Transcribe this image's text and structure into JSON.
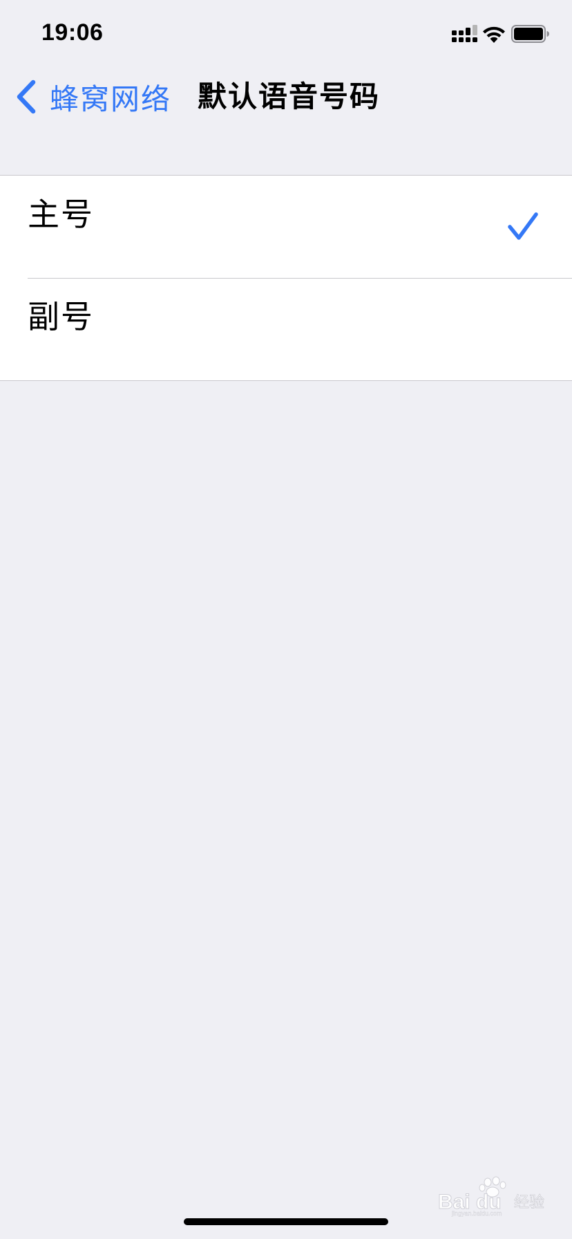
{
  "status_bar": {
    "time": "19:06",
    "icons": [
      "cellular-signal-icon",
      "wifi-icon",
      "battery-icon"
    ]
  },
  "nav": {
    "back_label": "蜂窝网络",
    "title": "默认语音号码",
    "back_icon": "chevron-left-icon"
  },
  "options": [
    {
      "label": "主号",
      "selected": true
    },
    {
      "label": "副号",
      "selected": false
    }
  ],
  "watermark": {
    "text": "Baidu 经验",
    "subtext": "jingyan.baidu.com"
  },
  "colors": {
    "accent": "#3478f6",
    "background": "#efeff4",
    "cell_background": "#ffffff",
    "separator": "#c8c7cc"
  }
}
